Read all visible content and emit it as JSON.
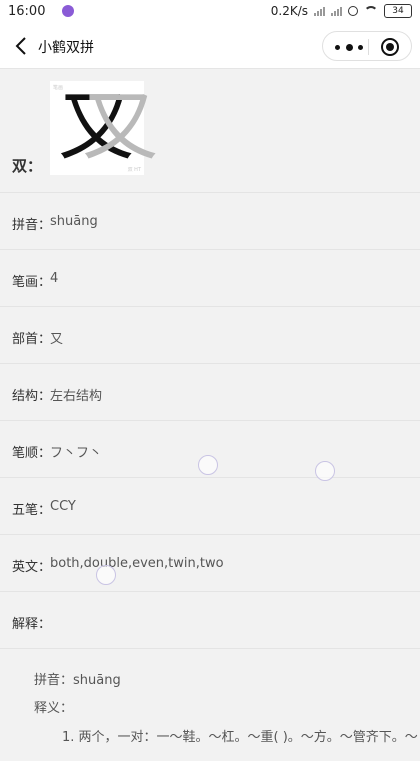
{
  "status_bar": {
    "time": "16:00",
    "network_speed": "0.2K/s",
    "battery": "34"
  },
  "nav": {
    "title": "小鹤双拼"
  },
  "char_section": {
    "label": "双：",
    "glyph_left": "又",
    "glyph_right": "又",
    "tiny_top": "笔画",
    "tiny_bottom": "双 HT"
  },
  "rows": [
    {
      "label": "拼音：",
      "value": "shuāng"
    },
    {
      "label": "笔画：",
      "value": "4"
    },
    {
      "label": "部首：",
      "value": "又"
    },
    {
      "label": "结构：",
      "value": "左右结构"
    },
    {
      "label": "笔顺：",
      "value": "フ丶フ丶"
    },
    {
      "label": "五笔：",
      "value": "CCY"
    },
    {
      "label": "英文：",
      "value": "both,double,even,twin,two"
    },
    {
      "label": "解释：",
      "value": ""
    }
  ],
  "explanation": {
    "pinyin_line": "拼音：shuāng",
    "meaning_label": "释义：",
    "item1": "1. 两个，一对：一～鞋。～杠。～重(  )。～方。～管齐下。～"
  }
}
